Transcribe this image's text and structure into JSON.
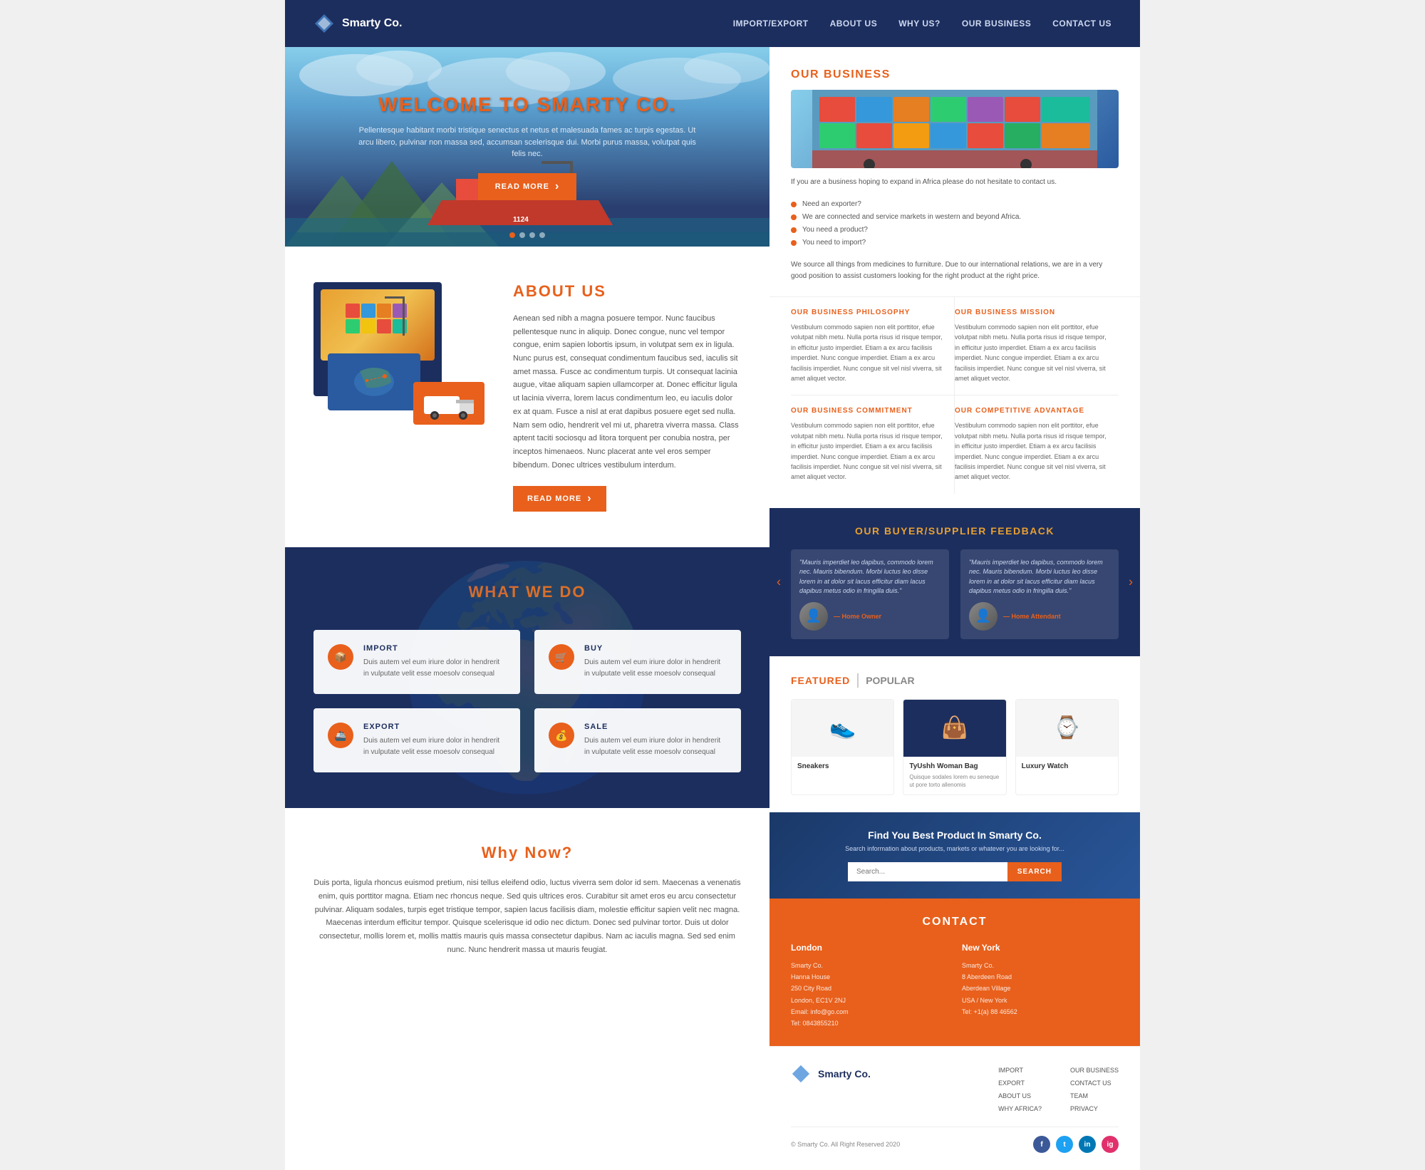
{
  "header": {
    "logo_text": "Smarty Co.",
    "nav_items": [
      {
        "label": "IMPORT/EXPORT",
        "href": "#"
      },
      {
        "label": "ABOUT US",
        "href": "#"
      },
      {
        "label": "WHY US?",
        "href": "#"
      },
      {
        "label": "OUR BUSINESS",
        "href": "#"
      },
      {
        "label": "CONTACT US",
        "href": "#"
      }
    ]
  },
  "hero": {
    "title_prefix": "WELCOME TO ",
    "title_brand": "SMARTY CO.",
    "subtitle": "Pellentesque habitant morbi tristique senectus et netus et malesuada fames ac turpis egestas. Ut arcu libero, pulvinar non massa sed, accumsan scelerisque dui. Morbi purus massa, volutpat quis felis nec.",
    "btn_label": "READ MORE",
    "dots": [
      true,
      true,
      true,
      false
    ]
  },
  "about": {
    "title": "ABOUT US",
    "text": "Aenean sed nibh a magna posuere tempor. Nunc faucibus pellentesque nunc in aliquip. Donec congue, nunc vel tempor congue, enim sapien lobortis ipsum, in volutpat sem ex in ligula. Nunc purus est, consequat condimentum faucibus sed, iaculis sit amet massa. Fusce ac condimentum turpis. Ut consequat lacinia augue, vitae aliquam sapien ullamcorper at. Donec efficitur ligula ut lacinia viverra, lorem lacus condimentum leo, eu iaculis dolor ex at quam. Fusce a nisl at erat dapibus posuere eget sed nulla. Nam sem odio, hendrerit vel mi ut, pharetra viverra massa. Class aptent taciti sociosqu ad litora torquent per conubia nostra, per inceptos himenaeos. Nunc placerat ante vel eros semper bibendum. Donec ultrices vestibulum interdum.",
    "btn_label": "READ MORE"
  },
  "what_we_do": {
    "title": "WHAT WE DO",
    "services": [
      {
        "name": "IMPORT",
        "icon": "📦",
        "desc": "Duis autem vel eum iriure dolor in hendrerit in vulputate velit esse moesolv consequal"
      },
      {
        "name": "BUY",
        "icon": "🛒",
        "desc": "Duis autem vel eum iriure dolor in hendrerit in vulputate velit esse moesolv consequal"
      },
      {
        "name": "EXPORT",
        "icon": "🚢",
        "desc": "Duis autem vel eum iriure dolor in hendrerit in vulputate velit esse moesolv consequal"
      },
      {
        "name": "SALE",
        "icon": "💰",
        "desc": "Duis autem vel eum iriure dolor in hendrerit in vulputate velit esse moesolv consequal"
      }
    ]
  },
  "why_now": {
    "title": "Why Now?",
    "text": "Duis porta, ligula rhoncus euismod pretium, nisi tellus eleifend odio, luctus viverra sem dolor id sem. Maecenas a venenatis enim, quis porttitor magna. Etiam nec rhoncus neque. Sed quis ultrices eros. Curabitur sit amet eros eu arcu consectetur pulvinar. Aliquam sodales, turpis eget tristique tempor, sapien lacus facilisis diam, molestie efficitur sapien velit nec magna. Maecenas interdum efficitur tempor. Quisque scelerisque id odio nec dictum. Donec sed pulvinar tortor. Duis ut dolor consectetur, mollis lorem et, mollis mattis mauris quis massa consectetur dapibus. Nam ac iaculis magna. Sed sed enim nunc. Nunc hendrerit massa ut mauris feugiat."
  },
  "our_business": {
    "title": "OUR BUSINESS",
    "intro": "If you are a business hoping to expand in Africa please do not hesitate to contact us.",
    "bullets": [
      "Need an exporter?",
      "We are connected and service markets in western and beyond Africa.",
      "You need a product?",
      "You need to import?"
    ],
    "footer_text": "We source all things from medicines to furniture. Due to our international relations, we are in a very good position to assist customers looking for the right product at the right price.",
    "sections": [
      {
        "title": "OUR BUSINESS PHILOSOPHY",
        "text": "Vestibulum commodo sapien non elit porttitor, efue volutpat nibh metu. Nulla porta risus id risque tempor, in efficitur justo imperdiet. Etiam a ex arcu facilisis imperdiet. Nunc congue imperdiet. Etiam a ex arcu facilisis imperdiet. Nunc congue sit vel nisl viverra, sit amet aliquet vector."
      },
      {
        "title": "OUR BUSINESS MISSION",
        "text": "Vestibulum commodo sapien non elit porttitor, efue volutpat nibh metu. Nulla porta risus id risque tempor, in efficitur justo imperdiet. Etiam a ex arcu facilisis imperdiet. Nunc congue imperdiet. Etiam a ex arcu facilisis imperdiet. Nunc congue sit vel nisl viverra, sit amet aliquet vector."
      },
      {
        "title": "OUR BUSINESS COMMITMENT",
        "text": "Vestibulum commodo sapien non elit porttitor, efue volutpat nibh metu. Nulla porta risus id risque tempor, in efficitur justo imperdiet. Etiam a ex arcu facilisis imperdiet. Nunc congue imperdiet. Etiam a ex arcu facilisis imperdiet. Nunc congue sit vel nisl viverra, sit amet aliquet vector."
      },
      {
        "title": "OUR COMPETITIVE ADVANTAGE",
        "text": "Vestibulum commodo sapien non elit porttitor, efue volutpat nibh metu. Nulla porta risus id risque tempor, in efficitur justo imperdiet. Etiam a ex arcu facilisis imperdiet. Nunc congue imperdiet. Etiam a ex arcu facilisis imperdiet. Nunc congue sit vel nisl viverra, sit amet aliquet vector."
      }
    ]
  },
  "testimonials": {
    "title": "OUR BUYER/SUPPLIER FEEDBACK",
    "items": [
      {
        "text": "\"Mauris imperdiet leo dapibus, commodo lorem nec. Mauris bibendum. Morbi luctus leo disse lorem in at dolor sit lacus efficitur diam lacus dapibus metus odio in fringilla duis.\"",
        "author": "— Home Owner"
      },
      {
        "text": "\"Mauris imperdiet leo dapibus, commodo lorem nec. Mauris bibendum. Morbi luctus leo disse lorem in at dolor sit lacus efficitur diam lacus dapibus metus odio in fringilla duis.\"",
        "author": "— Home Attendant"
      }
    ]
  },
  "featured": {
    "label": "FEATURED",
    "popular_label": "POPULAR",
    "products": [
      {
        "name": "Sneakers",
        "desc": "",
        "emoji": "👟"
      },
      {
        "name": "TyUshh Woman Bag",
        "desc": "Quisque sodales lorem eu seneque ut pore torto allenomis",
        "emoji": "👜",
        "highlight": true
      },
      {
        "name": "Luxury Watch",
        "desc": "",
        "emoji": "⌚"
      }
    ]
  },
  "find_product": {
    "title": "Find You Best Product In Smarty Co.",
    "subtitle": "Search information about products, markets or whatever you are looking for...",
    "placeholder": "Search...",
    "btn_label": "SEARCH"
  },
  "contact": {
    "title": "CONTACT",
    "london": {
      "city": "London",
      "company": "Smarty Co.",
      "address1": "Hanna House",
      "address2": "250 City Road",
      "address3": "London, EC1V 2NJ",
      "email": "Email: info@go.com",
      "tel": "Tel: 0843855210"
    },
    "new_york": {
      "city": "New York",
      "company": "Smarty Co.",
      "address1": "8 Aberdeen Road",
      "address2": "Aberdean Village",
      "address3": "USA / New York",
      "tel": "Tel: +1(a) 88 46562"
    }
  },
  "footer": {
    "logo_text": "Smarty Co.",
    "nav_col1": [
      {
        "label": "IMPORT"
      },
      {
        "label": "EXPORT"
      },
      {
        "label": "ABOUT US"
      },
      {
        "label": "WHY AFRICA?"
      }
    ],
    "nav_col2": [
      {
        "label": "OUR BUSINESS"
      },
      {
        "label": "CONTACT US"
      },
      {
        "label": "TEAM"
      },
      {
        "label": "PRIVACY"
      }
    ],
    "copyright": "© Smarty Co. All Right Reserved 2020",
    "social": [
      "f",
      "t",
      "in",
      "ig"
    ]
  }
}
